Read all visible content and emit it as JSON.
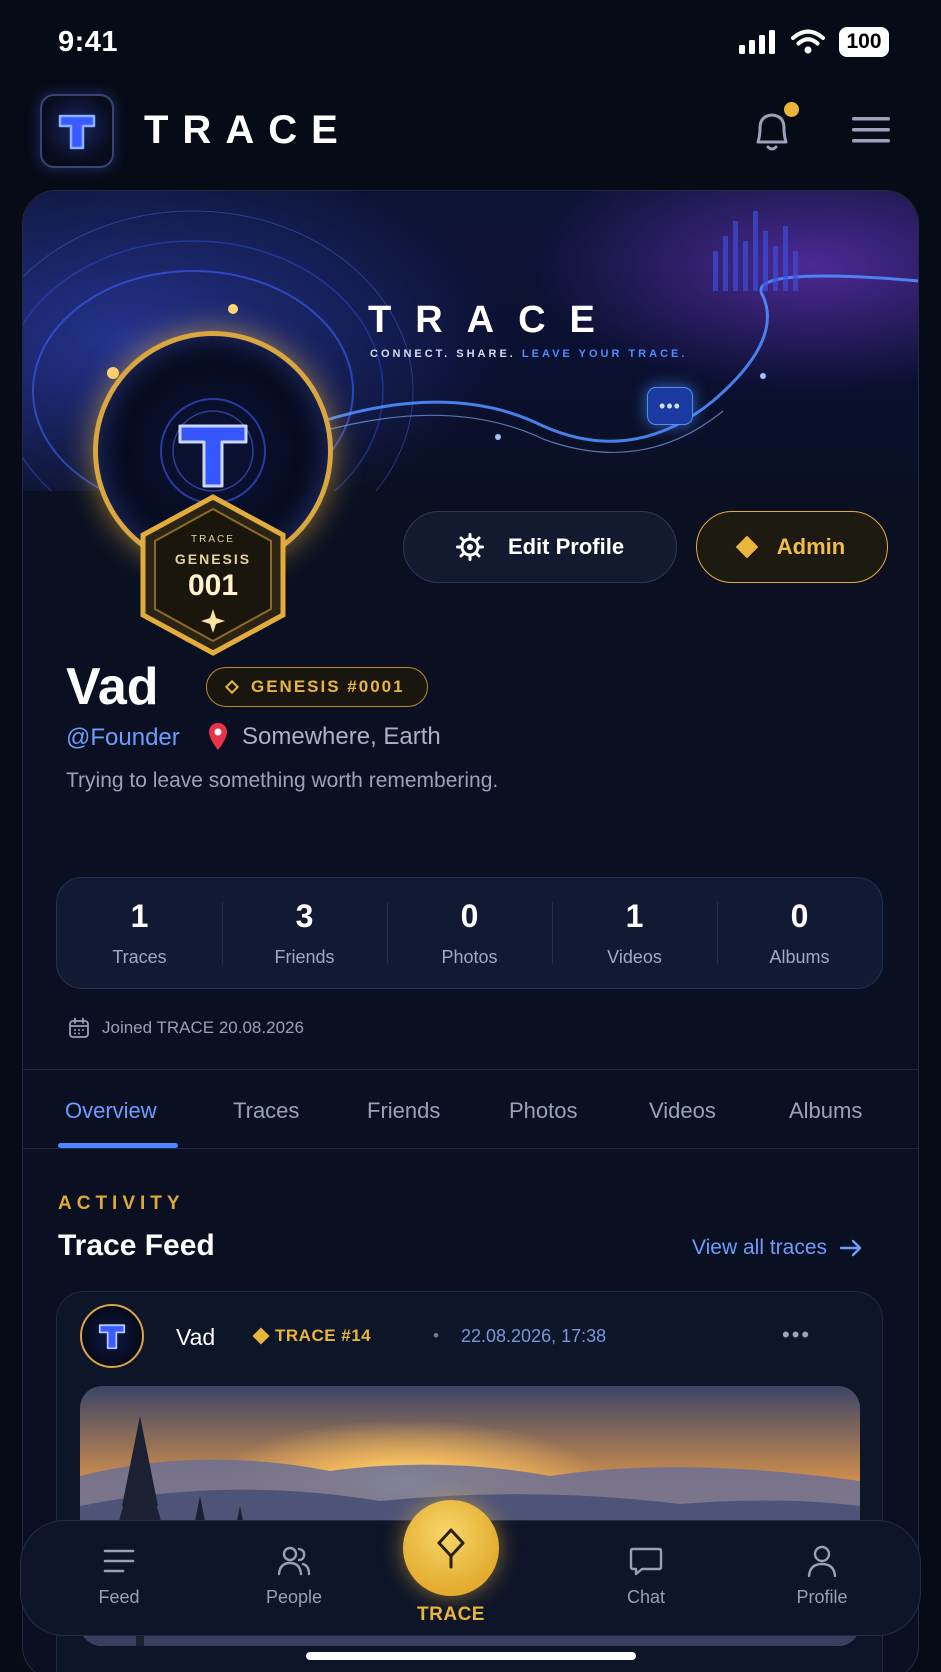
{
  "status_bar": {
    "time": "9:41",
    "battery": "100"
  },
  "header": {
    "app_title": "TRACE"
  },
  "cover": {
    "title": "TRACE",
    "tagline_part1": "CONNECT. SHARE. ",
    "tagline_highlight": "LEAVE YOUR TRACE.",
    "bubble_text": "•••"
  },
  "badge": {
    "small": "TRACE",
    "label": "GENESIS",
    "number": "001"
  },
  "avatar": {
    "letter": "T"
  },
  "actions": {
    "edit_profile": "Edit Profile",
    "admin": "Admin"
  },
  "profile": {
    "name": "Vad",
    "genesis_pill": "GENESIS #0001",
    "handle": "@Founder",
    "location": "Somewhere, Earth",
    "bio": "Trying to leave something worth remembering.",
    "joined": "Joined TRACE 20.08.2026"
  },
  "stats": [
    {
      "value": "1",
      "label": "Traces"
    },
    {
      "value": "3",
      "label": "Friends"
    },
    {
      "value": "0",
      "label": "Photos"
    },
    {
      "value": "1",
      "label": "Videos"
    },
    {
      "value": "0",
      "label": "Albums"
    }
  ],
  "tabs": [
    "Overview",
    "Traces",
    "Friends",
    "Photos",
    "Videos",
    "Albums"
  ],
  "activity": {
    "eyebrow": "ACTIVITY",
    "title": "Trace Feed",
    "view_all": "View all traces"
  },
  "post": {
    "author": "Vad",
    "trace_label": "TRACE #14",
    "separator": "•",
    "datetime": "22.08.2026, 17:38",
    "more": "•••"
  },
  "nav": {
    "feed": "Feed",
    "people": "People",
    "trace": "TRACE",
    "chat": "Chat",
    "profile": "Profile"
  },
  "colors": {
    "background": "#070b17",
    "accent_gold": "#e9b53c",
    "accent_blue": "#6f9cff",
    "card": "#0a1022"
  }
}
